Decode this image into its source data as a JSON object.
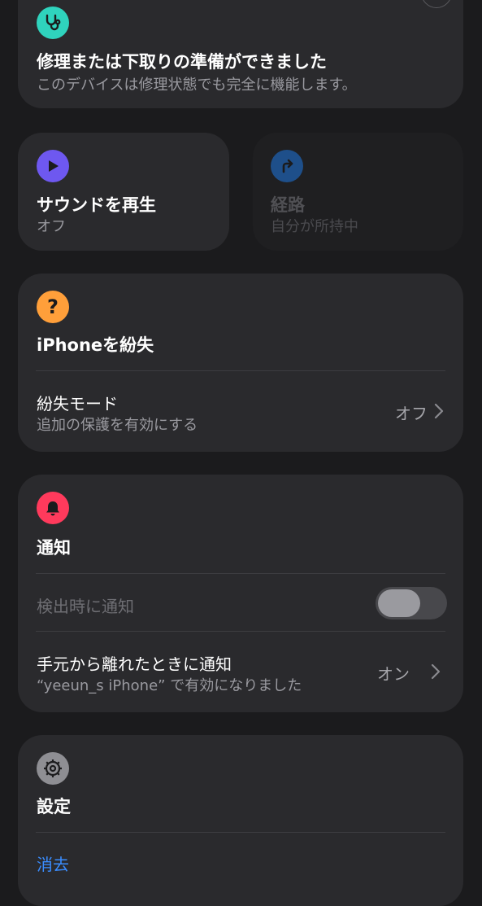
{
  "repair": {
    "title": "修理または下取りの準備ができました",
    "subtitle": "このデバイスは修理状態でも完全に機能します。"
  },
  "play_sound": {
    "title": "サウンドを再生",
    "subtitle": "オフ"
  },
  "directions": {
    "title": "経路",
    "subtitle": "自分が所持中"
  },
  "lost": {
    "title": "iPhoneを紛失",
    "mode_label": "紛失モード",
    "mode_sub": "追加の保護を有効にする",
    "mode_value": "オフ"
  },
  "notifications": {
    "title": "通知",
    "found_label": "検出時に通知",
    "found_toggle": false,
    "left_behind_label": "手元から離れたときに通知",
    "left_behind_sub": "“yeeun_s iPhone” で有効になりました",
    "left_behind_value": "オン"
  },
  "settings": {
    "title": "設定",
    "erase_label": "消去"
  },
  "colors": {
    "teal": "#2fd3bd",
    "purple": "#6e58f0",
    "blue": "#1e4f8a",
    "orange": "#ff9f3a",
    "red": "#ff3a5c",
    "gray": "#8e8e93",
    "link": "#3a8dff"
  }
}
